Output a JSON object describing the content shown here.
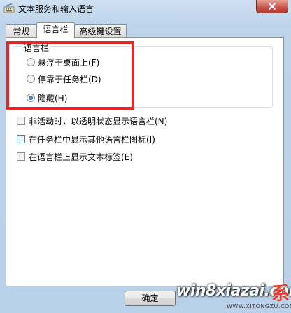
{
  "window": {
    "title": "文本服务和输入语言"
  },
  "tabs": [
    {
      "label": "常规"
    },
    {
      "label": "语言栏"
    },
    {
      "label": "高级键设置"
    }
  ],
  "language_bar": {
    "legend": "语言栏",
    "options": [
      {
        "label": "悬浮于桌面上(F)",
        "selected": false
      },
      {
        "label": "停靠于任务栏(D)",
        "selected": false
      },
      {
        "label": "隐藏(H)",
        "selected": true
      }
    ]
  },
  "checkboxes": [
    {
      "label": "非活动时，以透明状态显示语言栏(N)",
      "checked": false
    },
    {
      "label": "在任务栏中显示其他语言栏图标(I)",
      "checked": false
    },
    {
      "label": "在语言栏上显示文本标签(E)",
      "checked": false
    }
  ],
  "buttons": {
    "ok": "确定"
  },
  "watermark": {
    "text": "win8xiazai.com",
    "logo": "系",
    "sub": "WWW.XITONGZU.COM"
  },
  "colors": {
    "highlight_box": "#e8262a",
    "selected_radio": "#1c5180"
  }
}
